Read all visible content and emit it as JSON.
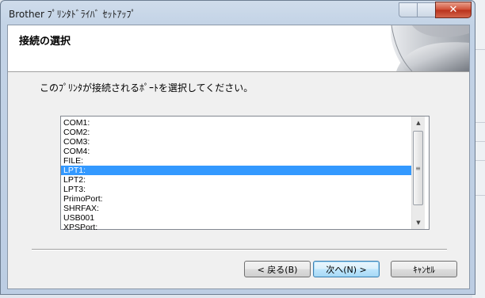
{
  "window": {
    "title": "Brother ﾌﾟﾘﾝﾀﾄﾞﾗｲﾊﾞ ｾｯﾄｱｯﾌﾟ"
  },
  "header": {
    "title": "接続の選択"
  },
  "instruction": "このﾌﾟﾘﾝﾀが接続されるﾎﾟｰﾄを選択してください。",
  "ports": [
    {
      "label": "COM1:",
      "selected": false
    },
    {
      "label": "COM2:",
      "selected": false
    },
    {
      "label": "COM3:",
      "selected": false
    },
    {
      "label": "COM4:",
      "selected": false
    },
    {
      "label": "FILE:",
      "selected": false
    },
    {
      "label": "LPT1:",
      "selected": true
    },
    {
      "label": "LPT2:",
      "selected": false
    },
    {
      "label": "LPT3:",
      "selected": false
    },
    {
      "label": "PrimoPort:",
      "selected": false
    },
    {
      "label": "SHRFAX:",
      "selected": false
    },
    {
      "label": "USB001",
      "selected": false
    },
    {
      "label": "XPSPort:",
      "selected": false
    }
  ],
  "buttons": {
    "back": "< 戻る(B)",
    "next": "次へ(N) >",
    "cancel": "ｷｬﾝｾﾙ"
  },
  "icons": {
    "close": "close-icon",
    "scroll_up": "scroll-up-arrow",
    "scroll_down": "scroll-down-arrow",
    "header_art": "page-curl-graphic"
  },
  "colors": {
    "selection": "#3399ff",
    "close_button": "#c8432b"
  }
}
